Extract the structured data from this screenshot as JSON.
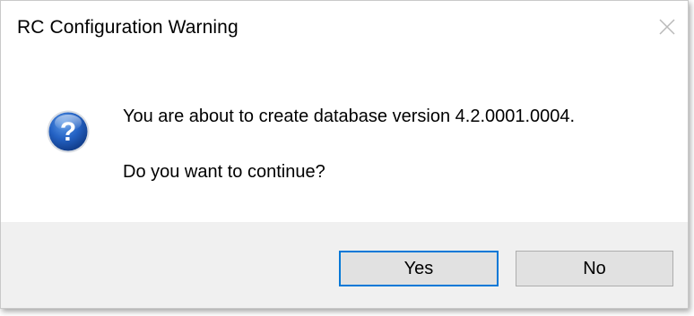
{
  "window": {
    "title": "RC Configuration Warning"
  },
  "message": {
    "line1": "You are about to create database version 4.2.0001.0004.",
    "line2": "Do you want to continue?",
    "icon": "question-icon"
  },
  "buttons": {
    "yes_label": "Yes",
    "no_label": "No"
  },
  "colors": {
    "footer_background": "#f0f0f0",
    "default_button_border": "#0078d7",
    "icon_blue": "#1f5fb8"
  }
}
